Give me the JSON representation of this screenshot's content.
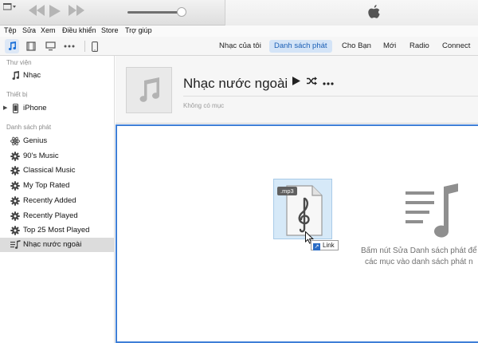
{
  "menu": {
    "items": [
      "Tệp",
      "Sửa",
      "Xem",
      "Điều khiển",
      "Store",
      "Trợ giúp"
    ]
  },
  "toolbar": {
    "tabs": [
      {
        "label": "Nhạc của tôi",
        "selected": false
      },
      {
        "label": "Danh sách phát",
        "selected": true
      },
      {
        "label": "Cho Bạn",
        "selected": false
      },
      {
        "label": "Mới",
        "selected": false
      },
      {
        "label": "Radio",
        "selected": false
      },
      {
        "label": "Connect",
        "selected": false
      }
    ]
  },
  "sidebar": {
    "library_title": "Thư viện",
    "library_items": [
      {
        "label": "Nhạc",
        "icon": "music-note-icon"
      }
    ],
    "devices_title": "Thiết bị",
    "device_items": [
      {
        "label": "iPhone",
        "icon": "iphone-icon"
      }
    ],
    "playlists_title": "Danh sách phát",
    "playlist_items": [
      {
        "label": "Genius",
        "icon": "genius-atom-icon"
      },
      {
        "label": "90's Music",
        "icon": "smart-playlist-gear-icon"
      },
      {
        "label": "Classical Music",
        "icon": "smart-playlist-gear-icon"
      },
      {
        "label": "My Top Rated",
        "icon": "smart-playlist-gear-icon"
      },
      {
        "label": "Recently Added",
        "icon": "smart-playlist-gear-icon"
      },
      {
        "label": "Recently Played",
        "icon": "smart-playlist-gear-icon"
      },
      {
        "label": "Top 25 Most Played",
        "icon": "smart-playlist-gear-icon"
      },
      {
        "label": "Nhạc nước ngoài",
        "icon": "playlist-icon",
        "selected": true
      }
    ]
  },
  "playlist": {
    "title": "Nhạc nước ngoài",
    "subtitle": "Không có mục"
  },
  "main": {
    "drag_file_tag": ".mp3",
    "drag_tooltip": "Link",
    "empty_line1": "Bấm nút Sửa Danh sách phát để",
    "empty_line2": "các mục vào danh sách phát n"
  },
  "colors": {
    "accent": "#1a6fd8",
    "selected_tab_bg": "#d4e4f7",
    "drop_border": "#3f7fd7"
  }
}
